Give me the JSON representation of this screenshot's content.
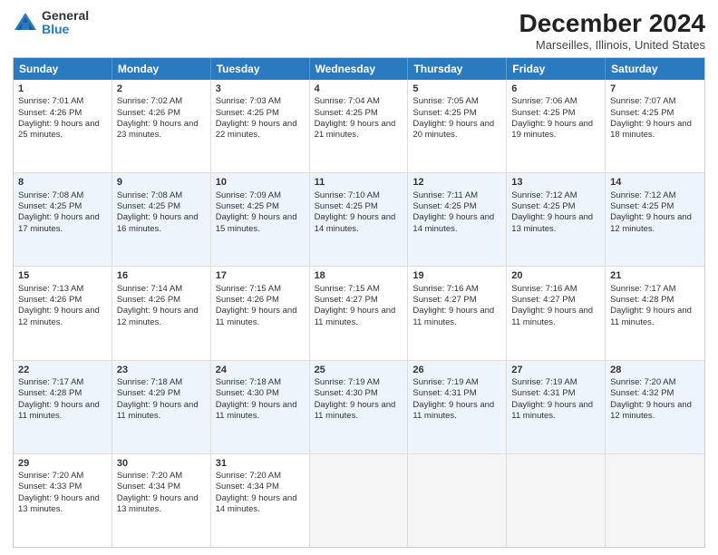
{
  "logo": {
    "general": "General",
    "blue": "Blue"
  },
  "title": "December 2024",
  "subtitle": "Marseilles, Illinois, United States",
  "days": [
    "Sunday",
    "Monday",
    "Tuesday",
    "Wednesday",
    "Thursday",
    "Friday",
    "Saturday"
  ],
  "weeks": [
    [
      {
        "day": 1,
        "sunrise": "Sunrise: 7:01 AM",
        "sunset": "Sunset: 4:26 PM",
        "daylight": "Daylight: 9 hours and 25 minutes."
      },
      {
        "day": 2,
        "sunrise": "Sunrise: 7:02 AM",
        "sunset": "Sunset: 4:26 PM",
        "daylight": "Daylight: 9 hours and 23 minutes."
      },
      {
        "day": 3,
        "sunrise": "Sunrise: 7:03 AM",
        "sunset": "Sunset: 4:25 PM",
        "daylight": "Daylight: 9 hours and 22 minutes."
      },
      {
        "day": 4,
        "sunrise": "Sunrise: 7:04 AM",
        "sunset": "Sunset: 4:25 PM",
        "daylight": "Daylight: 9 hours and 21 minutes."
      },
      {
        "day": 5,
        "sunrise": "Sunrise: 7:05 AM",
        "sunset": "Sunset: 4:25 PM",
        "daylight": "Daylight: 9 hours and 20 minutes."
      },
      {
        "day": 6,
        "sunrise": "Sunrise: 7:06 AM",
        "sunset": "Sunset: 4:25 PM",
        "daylight": "Daylight: 9 hours and 19 minutes."
      },
      {
        "day": 7,
        "sunrise": "Sunrise: 7:07 AM",
        "sunset": "Sunset: 4:25 PM",
        "daylight": "Daylight: 9 hours and 18 minutes."
      }
    ],
    [
      {
        "day": 8,
        "sunrise": "Sunrise: 7:08 AM",
        "sunset": "Sunset: 4:25 PM",
        "daylight": "Daylight: 9 hours and 17 minutes."
      },
      {
        "day": 9,
        "sunrise": "Sunrise: 7:08 AM",
        "sunset": "Sunset: 4:25 PM",
        "daylight": "Daylight: 9 hours and 16 minutes."
      },
      {
        "day": 10,
        "sunrise": "Sunrise: 7:09 AM",
        "sunset": "Sunset: 4:25 PM",
        "daylight": "Daylight: 9 hours and 15 minutes."
      },
      {
        "day": 11,
        "sunrise": "Sunrise: 7:10 AM",
        "sunset": "Sunset: 4:25 PM",
        "daylight": "Daylight: 9 hours and 14 minutes."
      },
      {
        "day": 12,
        "sunrise": "Sunrise: 7:11 AM",
        "sunset": "Sunset: 4:25 PM",
        "daylight": "Daylight: 9 hours and 14 minutes."
      },
      {
        "day": 13,
        "sunrise": "Sunrise: 7:12 AM",
        "sunset": "Sunset: 4:25 PM",
        "daylight": "Daylight: 9 hours and 13 minutes."
      },
      {
        "day": 14,
        "sunrise": "Sunrise: 7:12 AM",
        "sunset": "Sunset: 4:25 PM",
        "daylight": "Daylight: 9 hours and 12 minutes."
      }
    ],
    [
      {
        "day": 15,
        "sunrise": "Sunrise: 7:13 AM",
        "sunset": "Sunset: 4:26 PM",
        "daylight": "Daylight: 9 hours and 12 minutes."
      },
      {
        "day": 16,
        "sunrise": "Sunrise: 7:14 AM",
        "sunset": "Sunset: 4:26 PM",
        "daylight": "Daylight: 9 hours and 12 minutes."
      },
      {
        "day": 17,
        "sunrise": "Sunrise: 7:15 AM",
        "sunset": "Sunset: 4:26 PM",
        "daylight": "Daylight: 9 hours and 11 minutes."
      },
      {
        "day": 18,
        "sunrise": "Sunrise: 7:15 AM",
        "sunset": "Sunset: 4:27 PM",
        "daylight": "Daylight: 9 hours and 11 minutes."
      },
      {
        "day": 19,
        "sunrise": "Sunrise: 7:16 AM",
        "sunset": "Sunset: 4:27 PM",
        "daylight": "Daylight: 9 hours and 11 minutes."
      },
      {
        "day": 20,
        "sunrise": "Sunrise: 7:16 AM",
        "sunset": "Sunset: 4:27 PM",
        "daylight": "Daylight: 9 hours and 11 minutes."
      },
      {
        "day": 21,
        "sunrise": "Sunrise: 7:17 AM",
        "sunset": "Sunset: 4:28 PM",
        "daylight": "Daylight: 9 hours and 11 minutes."
      }
    ],
    [
      {
        "day": 22,
        "sunrise": "Sunrise: 7:17 AM",
        "sunset": "Sunset: 4:28 PM",
        "daylight": "Daylight: 9 hours and 11 minutes."
      },
      {
        "day": 23,
        "sunrise": "Sunrise: 7:18 AM",
        "sunset": "Sunset: 4:29 PM",
        "daylight": "Daylight: 9 hours and 11 minutes."
      },
      {
        "day": 24,
        "sunrise": "Sunrise: 7:18 AM",
        "sunset": "Sunset: 4:30 PM",
        "daylight": "Daylight: 9 hours and 11 minutes."
      },
      {
        "day": 25,
        "sunrise": "Sunrise: 7:19 AM",
        "sunset": "Sunset: 4:30 PM",
        "daylight": "Daylight: 9 hours and 11 minutes."
      },
      {
        "day": 26,
        "sunrise": "Sunrise: 7:19 AM",
        "sunset": "Sunset: 4:31 PM",
        "daylight": "Daylight: 9 hours and 11 minutes."
      },
      {
        "day": 27,
        "sunrise": "Sunrise: 7:19 AM",
        "sunset": "Sunset: 4:31 PM",
        "daylight": "Daylight: 9 hours and 11 minutes."
      },
      {
        "day": 28,
        "sunrise": "Sunrise: 7:20 AM",
        "sunset": "Sunset: 4:32 PM",
        "daylight": "Daylight: 9 hours and 12 minutes."
      }
    ],
    [
      {
        "day": 29,
        "sunrise": "Sunrise: 7:20 AM",
        "sunset": "Sunset: 4:33 PM",
        "daylight": "Daylight: 9 hours and 13 minutes."
      },
      {
        "day": 30,
        "sunrise": "Sunrise: 7:20 AM",
        "sunset": "Sunset: 4:34 PM",
        "daylight": "Daylight: 9 hours and 13 minutes."
      },
      {
        "day": 31,
        "sunrise": "Sunrise: 7:20 AM",
        "sunset": "Sunset: 4:34 PM",
        "daylight": "Daylight: 9 hours and 14 minutes."
      },
      null,
      null,
      null,
      null
    ]
  ],
  "alt_rows": [
    1,
    3
  ]
}
